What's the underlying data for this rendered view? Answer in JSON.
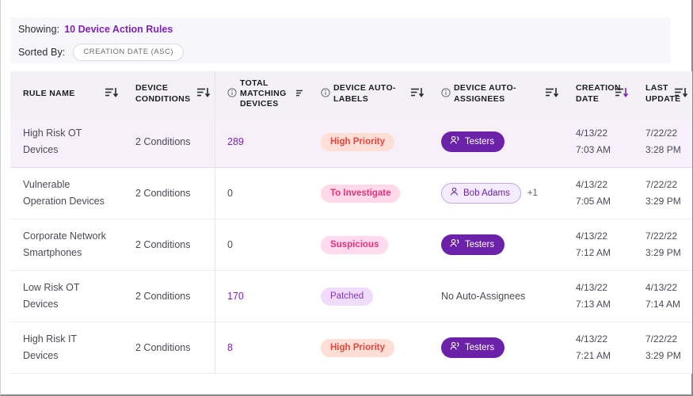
{
  "filter_bar": {
    "showing_label": "Showing:",
    "showing_value": "10 Device Action Rules",
    "sorted_label": "Sorted By:",
    "sort_chip": "CREATION DATE (ASC)"
  },
  "table": {
    "columns": [
      {
        "id": "rule_name",
        "label": "RULE NAME",
        "info": false,
        "sorted": false
      },
      {
        "id": "device_conditions",
        "label": "DEVICE CONDITIONS",
        "info": false,
        "sorted": false
      },
      {
        "id": "total_matching_devices",
        "label": "TOTAL MATCHING DEVICES",
        "info": true,
        "sorted": false
      },
      {
        "id": "device_auto_labels",
        "label": "DEVICE AUTO-LABELS",
        "info": true,
        "sorted": false
      },
      {
        "id": "device_auto_assignees",
        "label": "DEVICE AUTO-ASSIGNEES",
        "info": true,
        "sorted": false
      },
      {
        "id": "creation_date",
        "label": "CREATION DATE",
        "info": false,
        "sorted": true
      },
      {
        "id": "last_update",
        "label": "LAST UPDATE",
        "info": false,
        "sorted": false
      }
    ],
    "rows": [
      {
        "rule_name": "High Risk OT Devices",
        "device_conditions": "2 Conditions",
        "total_matching_devices": "289",
        "total_is_link": true,
        "label_badge": "High Priority",
        "label_style": "high",
        "assignee_badge": "Testers",
        "assignee_style": "group",
        "assignee_extra": "",
        "creation_date": "4/13/22",
        "creation_time": "7:03 AM",
        "update_date": "7/22/22",
        "update_time": "3:28 PM",
        "selected": true
      },
      {
        "rule_name": "Vulnerable Operation Devices",
        "device_conditions": "2 Conditions",
        "total_matching_devices": "0",
        "total_is_link": false,
        "label_badge": "To Investigate",
        "label_style": "investigate",
        "assignee_badge": "Bob Adams",
        "assignee_style": "person",
        "assignee_extra": "+1",
        "creation_date": "4/13/22",
        "creation_time": "7:05 AM",
        "update_date": "7/22/22",
        "update_time": "3:29 PM",
        "selected": false
      },
      {
        "rule_name": "Corporate Network Smartphones",
        "device_conditions": "2 Conditions",
        "total_matching_devices": "0",
        "total_is_link": false,
        "label_badge": "Suspicious",
        "label_style": "suspicious",
        "assignee_badge": "Testers",
        "assignee_style": "group",
        "assignee_extra": "",
        "creation_date": "4/13/22",
        "creation_time": "7:12 AM",
        "update_date": "7/22/22",
        "update_time": "3:29 PM",
        "selected": false
      },
      {
        "rule_name": "Low Risk OT Devices",
        "device_conditions": "2 Conditions",
        "total_matching_devices": "170",
        "total_is_link": true,
        "label_badge": "Patched",
        "label_style": "patched",
        "assignee_badge": "No Auto-Assignees",
        "assignee_style": "none",
        "assignee_extra": "",
        "creation_date": "4/13/22",
        "creation_time": "7:13 AM",
        "update_date": "4/13/22",
        "update_time": "7:14 AM",
        "selected": false
      },
      {
        "rule_name": "High Risk IT Devices",
        "device_conditions": "2 Conditions",
        "total_matching_devices": "8",
        "total_is_link": true,
        "label_badge": "High Priority",
        "label_style": "high",
        "assignee_badge": "Testers",
        "assignee_style": "group",
        "assignee_extra": "",
        "creation_date": "4/13/22",
        "creation_time": "7:21 AM",
        "update_date": "7/22/22",
        "update_time": "3:29 PM",
        "selected": false
      }
    ]
  },
  "colors": {
    "accent_purple": "#7d22ba",
    "pill_purple": "#6b21a8",
    "selected_row": "#f7f0fb",
    "header_bg": "#f3f1f5",
    "band_bg": "#f7f7fb",
    "badge_high_bg": "#ffdfd5",
    "badge_high_fg": "#e8453c",
    "badge_pink_bg": "#ffd9e8",
    "badge_pink_fg": "#e8317e",
    "badge_patched_bg": "#efdcfb",
    "badge_patched_fg": "#8b2fc9"
  }
}
